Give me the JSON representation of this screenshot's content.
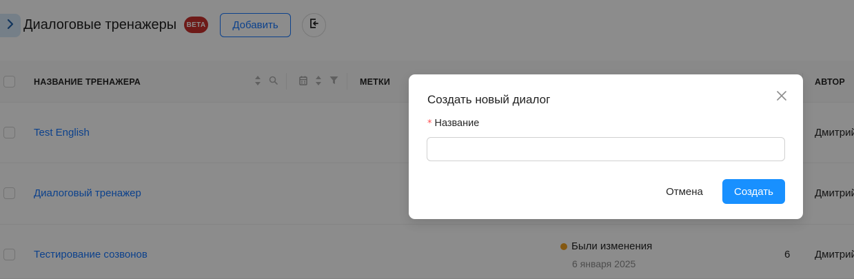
{
  "header": {
    "title": "Диалоговые тренажеры",
    "beta_badge": "BETA",
    "add_button_label": "Добавить",
    "expand_icon": "chevron-right-icon",
    "export_icon": "exit-icon"
  },
  "table": {
    "columns": {
      "name": "НАЗВАНИЕ ТРЕНАЖЕРА",
      "tags": "МЕТКИ",
      "author": "АВТОР"
    },
    "rows": [
      {
        "name": "Test English",
        "author": "Дмитрий",
        "count": "",
        "status": "",
        "status_date": ""
      },
      {
        "name": "Диалоговый тренажер",
        "author": "Дмитрий",
        "count": "",
        "status": "",
        "status_date": ""
      },
      {
        "name": "Тестирование созвонов",
        "author": "Дмитрий",
        "count": "6",
        "status": "Были изменения",
        "status_date": "6 января 2025"
      }
    ]
  },
  "modal": {
    "title": "Создать новый диалог",
    "field_label": "Название",
    "required_mark": "*",
    "input_value": "",
    "input_placeholder": "",
    "cancel_label": "Отмена",
    "create_label": "Создать"
  },
  "colors": {
    "accent": "#1677ff",
    "primary_button": "#1890ff",
    "beta_badge": "#c9302c",
    "status_changed": "#f0a020",
    "overlay": "rgba(0,0,0,0.45)"
  }
}
